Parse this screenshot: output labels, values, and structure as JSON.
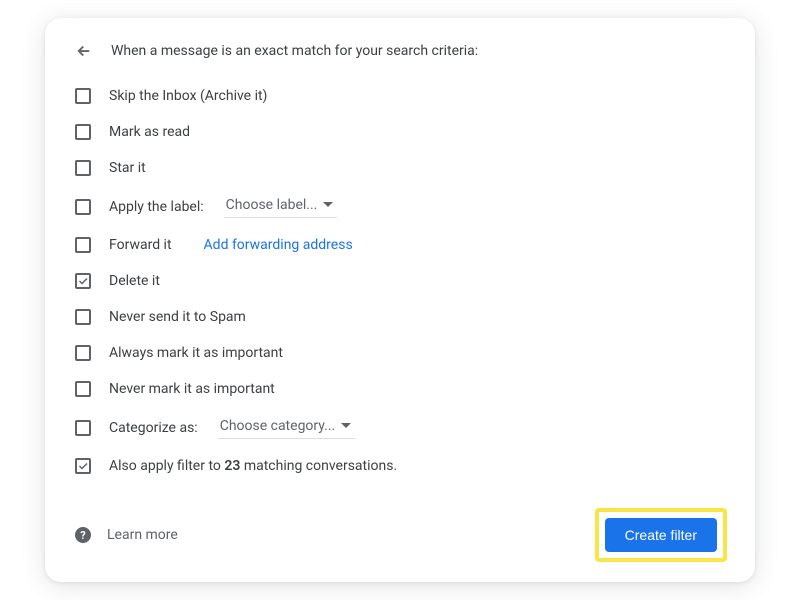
{
  "header": {
    "title": "When a message is an exact match for your search criteria:"
  },
  "options": {
    "skip_inbox": {
      "label": "Skip the Inbox (Archive it)",
      "checked": false
    },
    "mark_read": {
      "label": "Mark as read",
      "checked": false
    },
    "star": {
      "label": "Star it",
      "checked": false
    },
    "apply_label": {
      "label": "Apply the label:",
      "dropdown": "Choose label...",
      "checked": false
    },
    "forward": {
      "label": "Forward it",
      "link": "Add forwarding address",
      "checked": false
    },
    "delete": {
      "label": "Delete it",
      "checked": true
    },
    "never_spam": {
      "label": "Never send it to Spam",
      "checked": false
    },
    "always_important": {
      "label": "Always mark it as important",
      "checked": false
    },
    "never_important": {
      "label": "Never mark it as important",
      "checked": false
    },
    "categorize": {
      "label": "Categorize as:",
      "dropdown": "Choose category...",
      "checked": false
    },
    "also_apply": {
      "prefix": "Also apply filter to ",
      "count": "23",
      "suffix": " matching conversations.",
      "checked": true
    }
  },
  "footer": {
    "learn_more": "Learn more",
    "create_filter": "Create filter"
  }
}
